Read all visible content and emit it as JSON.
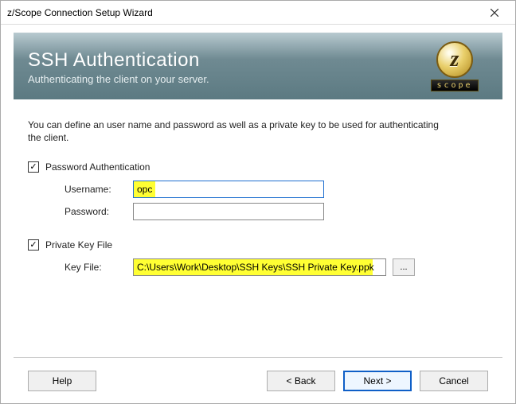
{
  "window": {
    "title": "z/Scope Connection Setup Wizard"
  },
  "banner": {
    "title": "SSH Authentication",
    "subtitle": "Authenticating the client on your server.",
    "logo_letter": "z",
    "logo_word": "scope"
  },
  "intro": "You can define an user name and password as well as a private key to be used for authenticating the client.",
  "auth": {
    "password_checkbox_label": "Password Authentication",
    "username_label": "Username:",
    "username_value": "opc",
    "password_label": "Password:",
    "password_value": ""
  },
  "key": {
    "checkbox_label": "Private Key File",
    "file_label": "Key File:",
    "file_value": "C:\\Users\\Work\\Desktop\\SSH Keys\\SSH Private Key.ppk",
    "browse_label": "..."
  },
  "footer": {
    "help": "Help",
    "back": "< Back",
    "next": "Next >",
    "cancel": "Cancel"
  }
}
